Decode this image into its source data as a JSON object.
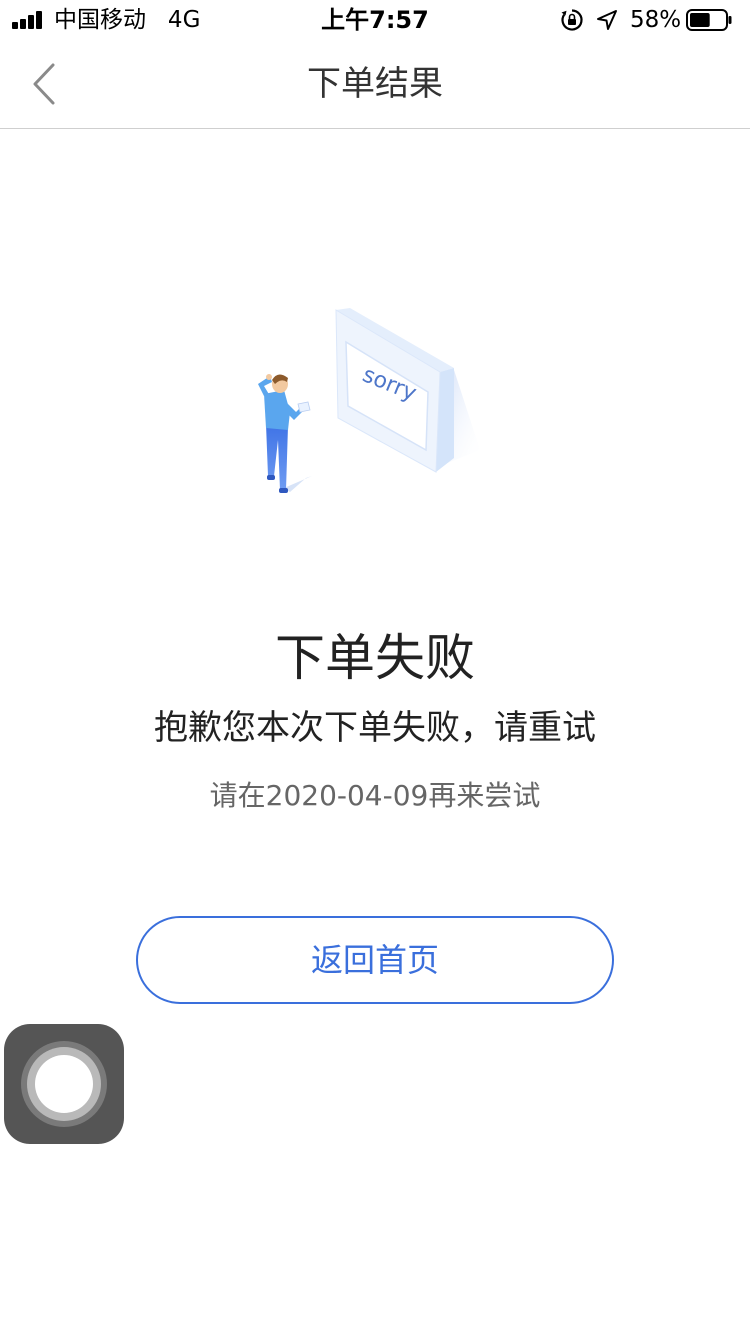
{
  "status_bar": {
    "carrier": "中国移动   4G",
    "time": "上午7:57",
    "battery_percent": "58%",
    "battery_level": 0.58,
    "signal_bars": 4,
    "icons": [
      "signal-icon",
      "orientation-lock-icon",
      "location-arrow-icon",
      "battery-icon"
    ]
  },
  "nav": {
    "title": "下单结果",
    "back_icon": "chevron-left-icon"
  },
  "illustration": {
    "screen_text": "sorry"
  },
  "result": {
    "title": "下单失败",
    "message": "抱歉您本次下单失败，请重试",
    "hint": "请在2020-04-09再来尝试"
  },
  "actions": {
    "home_label": "返回首页"
  },
  "colors": {
    "accent": "#3a6fdc",
    "text_primary": "#222222",
    "text_secondary": "#666666",
    "divider": "#cfcfcf"
  }
}
